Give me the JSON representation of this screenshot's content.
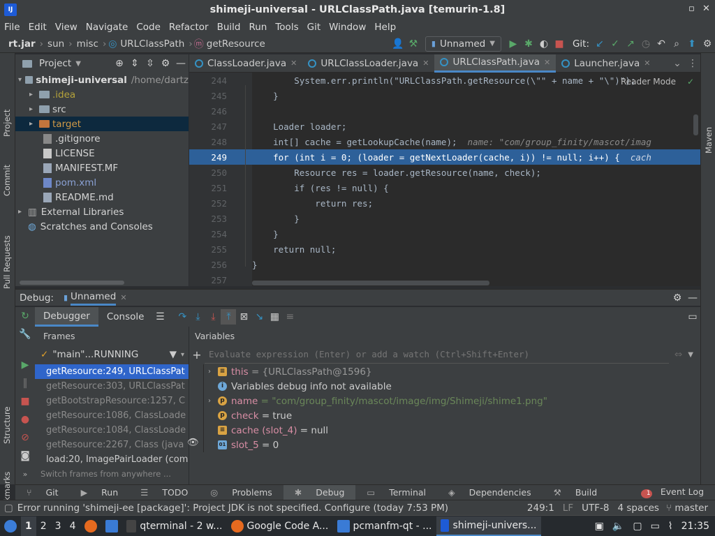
{
  "window": {
    "title": "shimeji-universal - URLClassPath.java [temurin-1.8]",
    "logo": "IJ"
  },
  "menu": [
    "File",
    "Edit",
    "View",
    "Navigate",
    "Code",
    "Refactor",
    "Build",
    "Run",
    "Tools",
    "Git",
    "Window",
    "Help"
  ],
  "breadcrumb": [
    "rt.jar",
    "sun",
    "misc",
    "URLClassPath",
    "getResource"
  ],
  "toolbar": {
    "run_config": "Unnamed",
    "git_label": "Git:"
  },
  "project": {
    "header": "Project",
    "items": [
      {
        "label": "shimeji-universal",
        "suffix": "/home/dartz",
        "level": 0,
        "arrow": "▾",
        "color": "#dcdcdc"
      },
      {
        "label": ".idea",
        "level": 1,
        "arrow": "▸",
        "color": "#b5a33a"
      },
      {
        "label": "src",
        "level": 1,
        "arrow": "▸",
        "color": "#dcdcdc"
      },
      {
        "label": "target",
        "level": 1,
        "arrow": "▸",
        "color": "#d19a46"
      },
      {
        "label": ".gitignore",
        "level": 1,
        "arrow": "",
        "color": "#dcdcdc"
      },
      {
        "label": "LICENSE",
        "level": 1,
        "arrow": "",
        "color": "#dcdcdc"
      },
      {
        "label": "MANIFEST.MF",
        "level": 1,
        "arrow": "",
        "color": "#dcdcdc"
      },
      {
        "label": "pom.xml",
        "level": 1,
        "arrow": "",
        "color": "#8aa1d4"
      },
      {
        "label": "README.md",
        "level": 1,
        "arrow": "",
        "color": "#dcdcdc"
      },
      {
        "label": "External Libraries",
        "level": 0,
        "arrow": "▸",
        "color": "#dcdcdc"
      },
      {
        "label": "Scratches and Consoles",
        "level": 0,
        "arrow": "",
        "color": "#dcdcdc"
      }
    ]
  },
  "tabs": [
    {
      "label": "ClassLoader.java",
      "active": false
    },
    {
      "label": "URLClassLoader.java",
      "active": false
    },
    {
      "label": "URLClassPath.java",
      "active": true
    },
    {
      "label": "Launcher.java",
      "active": false
    }
  ],
  "editor": {
    "reader_mode": "Reader Mode",
    "lines": [
      {
        "n": "244",
        "code": "        System.err.println(\"URLClassPath.getResource(\\\"\" + name + \"\\\")\");",
        "hint": ""
      },
      {
        "n": "245",
        "code": "    }",
        "hint": ""
      },
      {
        "n": "246",
        "code": "",
        "hint": ""
      },
      {
        "n": "247",
        "code": "    Loader loader;",
        "hint": ""
      },
      {
        "n": "248",
        "code": "    int[] cache = getLookupCache(name);",
        "hint": "  name: \"com/group_finity/mascot/imag"
      },
      {
        "n": "249",
        "code": "    for (int i = 0; (loader = getNextLoader(cache, i)) != null; i++) {",
        "hint": "  cach"
      },
      {
        "n": "250",
        "code": "        Resource res = loader.getResource(name, check);",
        "hint": ""
      },
      {
        "n": "251",
        "code": "        if (res != null) {",
        "hint": ""
      },
      {
        "n": "252",
        "code": "            return res;",
        "hint": ""
      },
      {
        "n": "253",
        "code": "        }",
        "hint": ""
      },
      {
        "n": "254",
        "code": "    }",
        "hint": ""
      },
      {
        "n": "255",
        "code": "    return null;",
        "hint": ""
      },
      {
        "n": "256",
        "code": "}",
        "hint": ""
      },
      {
        "n": "257",
        "code": "",
        "hint": ""
      }
    ]
  },
  "debug": {
    "label": "Debug:",
    "session": "Unnamed",
    "tab_debugger": "Debugger",
    "tab_console": "Console",
    "frames_header": "Frames",
    "variables_header": "Variables",
    "thread": "\"main\"...RUNNING",
    "frames": [
      "getResource:249, URLClassPat",
      "getResource:303, URLClassPat",
      "getBootstrapResource:1257, C",
      "getResource:1086, ClassLoade",
      "getResource:1084, ClassLoade",
      "getResource:2267, Class (java",
      "load:20, ImagePairLoader (com"
    ],
    "switch_hint": "Switch frames from anywhere ...",
    "eval_placeholder": "Evaluate expression (Enter) or add a watch (Ctrl+Shift+Enter)",
    "vars": [
      {
        "name": "this",
        "value": "= {URLClassPath@1596}",
        "arrow": true,
        "icon": "#d9a343",
        "glyph": "≡"
      },
      {
        "name": "",
        "value": "Variables debug info not available",
        "arrow": false,
        "icon": "#6ea8d8",
        "glyph": "i"
      },
      {
        "name": "name",
        "value": "= \"com/group_finity/mascot/image/img/Shimeji/shime1.png\"",
        "arrow": true,
        "icon": "#d9a343",
        "glyph": "p"
      },
      {
        "name": "check",
        "value": "= true",
        "arrow": false,
        "icon": "#d9a343",
        "glyph": "p"
      },
      {
        "name": "cache (slot_4)",
        "value": "= null",
        "arrow": false,
        "icon": "#d9a343",
        "glyph": "≡"
      },
      {
        "name": "slot_5",
        "value": "= 0",
        "arrow": false,
        "icon": "#6ea8d8",
        "glyph": "01"
      }
    ]
  },
  "toolwindows": [
    "Git",
    "Run",
    "TODO",
    "Problems",
    "Debug",
    "Terminal",
    "Dependencies",
    "Build"
  ],
  "event_log": "Event Log",
  "event_count": "1",
  "status": {
    "message": "Error running 'shimeji-ee [package]': Project JDK is not specified. Configure (today 7:53 PM)",
    "position": "249:1",
    "line_sep": "LF",
    "encoding": "UTF-8",
    "indent": "4 spaces",
    "branch": "master"
  },
  "side_labels": {
    "project": "Project",
    "commit": "Commit",
    "pull": "Pull Requests",
    "structure": "Structure",
    "bookmarks": "Bookmarks",
    "maven": "Maven"
  },
  "taskbar": {
    "workspaces": [
      "1",
      "2",
      "3",
      "4"
    ],
    "tasks": [
      "qterminal - 2 w...",
      "Google Code A...",
      "pcmanfm-qt - ...",
      "shimeji-univers..."
    ],
    "clock": "21:35"
  }
}
